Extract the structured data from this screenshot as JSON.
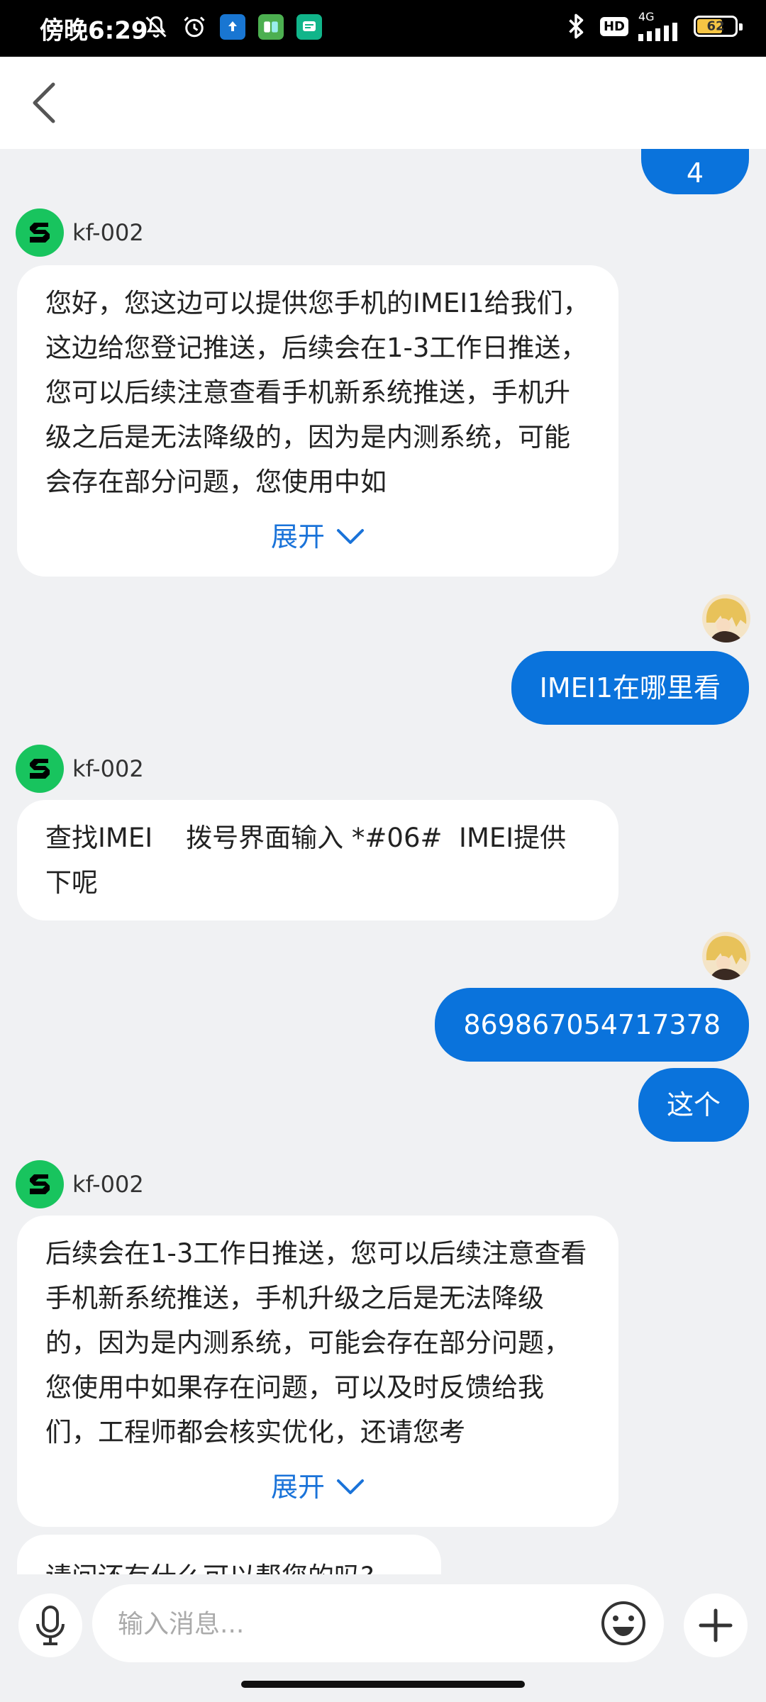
{
  "status_bar": {
    "time": "傍晚6:29",
    "hd": "HD",
    "network": "4G",
    "battery": "62"
  },
  "messages": {
    "top_partial": "4",
    "agent_name": "kf-002",
    "msg1": "您好，您这边可以提供您手机的IMEI1给我们，这边给您登记推送，后续会在1-3工作日推送，您可以后续注意查看手机新系统推送，手机升级之后是无法降级的，因为是内测系统，可能会存在部分问题，您使用中如",
    "expand_label": "展开",
    "user_q1": "IMEI1在哪里看",
    "msg2": "查找IMEI    拨号界面输入 *#06#  IMEI提供下呢",
    "user_imei": "869867054717378",
    "user_this": "这个",
    "msg3": "后续会在1-3工作日推送，您可以后续注意查看手机新系统推送，手机升级之后是无法降级的，因为是内测系统，可能会存在部分问题，您使用中如果存在问题，可以及时反馈给我们，工程师都会核实优化，还请您考",
    "msg4_partial": "请问还有什么可以帮您的吗?"
  },
  "input": {
    "placeholder": "输入消息..."
  }
}
